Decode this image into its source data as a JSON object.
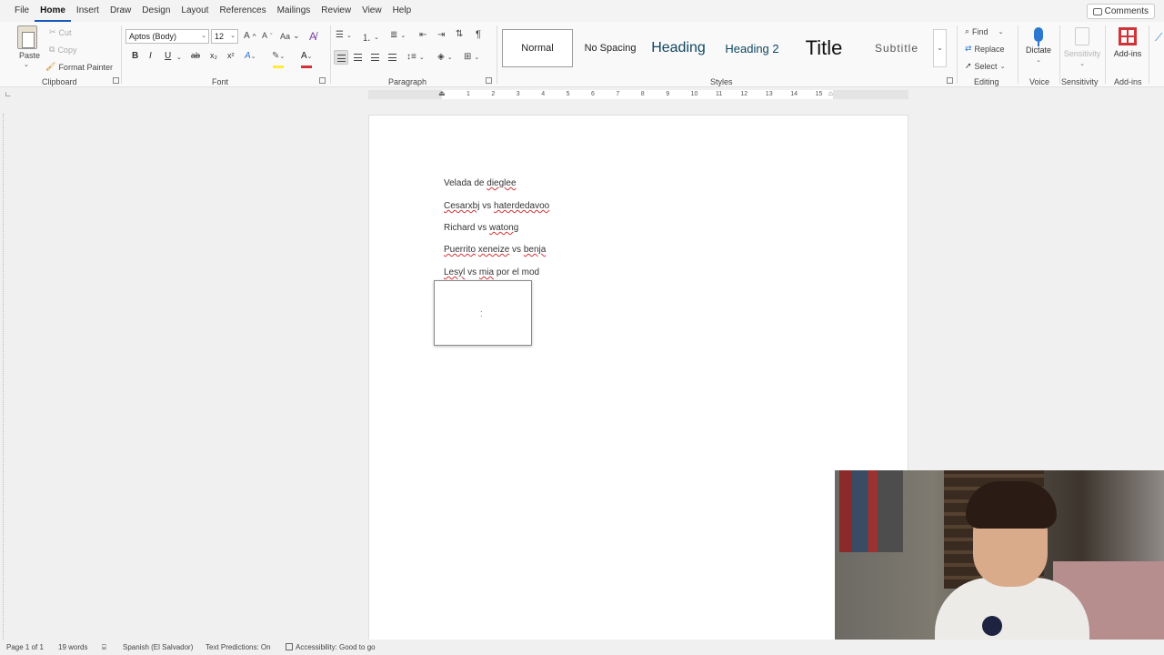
{
  "menu": {
    "items": [
      "File",
      "Home",
      "Insert",
      "Draw",
      "Design",
      "Layout",
      "References",
      "Mailings",
      "Review",
      "View",
      "Help"
    ],
    "comments_label": "Comments"
  },
  "clipboard": {
    "paste": "Paste",
    "cut": "Cut",
    "copy": "Copy",
    "format_painter": "Format Painter",
    "group_label": "Clipboard"
  },
  "font": {
    "name": "Aptos (Body)",
    "size": "12",
    "group_label": "Font",
    "bold": "B",
    "italic": "I",
    "underline": "U",
    "strikethrough": "ab",
    "subscript": "x₂",
    "superscript": "x²",
    "grow": "A",
    "shrink": "A",
    "change_case": "Aa",
    "font_color_glyph": "A",
    "highlight_color": "#ffeb3b",
    "font_color": "#d13438"
  },
  "paragraph": {
    "group_label": "Paragraph",
    "pilcrow": "¶"
  },
  "styles": {
    "group_label": "Styles",
    "items": [
      "Normal",
      "No Spacing",
      "Heading",
      "Heading 2",
      "Title",
      "Subtitle"
    ],
    "selected": "Normal"
  },
  "editing": {
    "group_label": "Editing",
    "find": "Find",
    "replace": "Replace",
    "select": "Select"
  },
  "voice": {
    "dictate": "Dictate",
    "group_label": "Voice"
  },
  "sensitivity": {
    "label": "Sensitivity",
    "group_label": "Sensitivity"
  },
  "addins": {
    "label": "Add-ins",
    "group_label": "Add-ins"
  },
  "ruler": {
    "ticks": [
      "1",
      "2",
      "3",
      "4",
      "5",
      "6",
      "7",
      "8",
      "9",
      "10",
      "11",
      "12",
      "13",
      "14",
      "15"
    ]
  },
  "document": {
    "lines": [
      {
        "parts": [
          {
            "t": "Velada de ",
            "sq": false
          },
          {
            "t": "dieglee",
            "sq": true
          }
        ]
      },
      {
        "parts": [
          {
            "t": "Cesarxbj",
            "sq": true
          },
          {
            "t": " vs ",
            "sq": false
          },
          {
            "t": "haterdedavoo",
            "sq": true
          }
        ]
      },
      {
        "parts": [
          {
            "t": "Richard vs ",
            "sq": false
          },
          {
            "t": "watong",
            "sq": true
          }
        ]
      },
      {
        "parts": [
          {
            "t": "Puerrito",
            "sq": true
          },
          {
            "t": " ",
            "sq": false
          },
          {
            "t": "xeneize",
            "sq": true
          },
          {
            "t": " vs ",
            "sq": false
          },
          {
            "t": "benja",
            "sq": true
          }
        ]
      },
      {
        "parts": [
          {
            "t": "Lesyl",
            "sq": true
          },
          {
            "t": " vs ",
            "sq": false
          },
          {
            "t": "mia",
            "sq": true
          },
          {
            "t": " por el mod",
            "sq": false
          }
        ]
      }
    ]
  },
  "status": {
    "page": "Page 1 of 1",
    "words": "19 words",
    "language": "Spanish (El Salvador)",
    "predictions": "Text Predictions: On",
    "accessibility": "Accessibility: Good to go"
  }
}
